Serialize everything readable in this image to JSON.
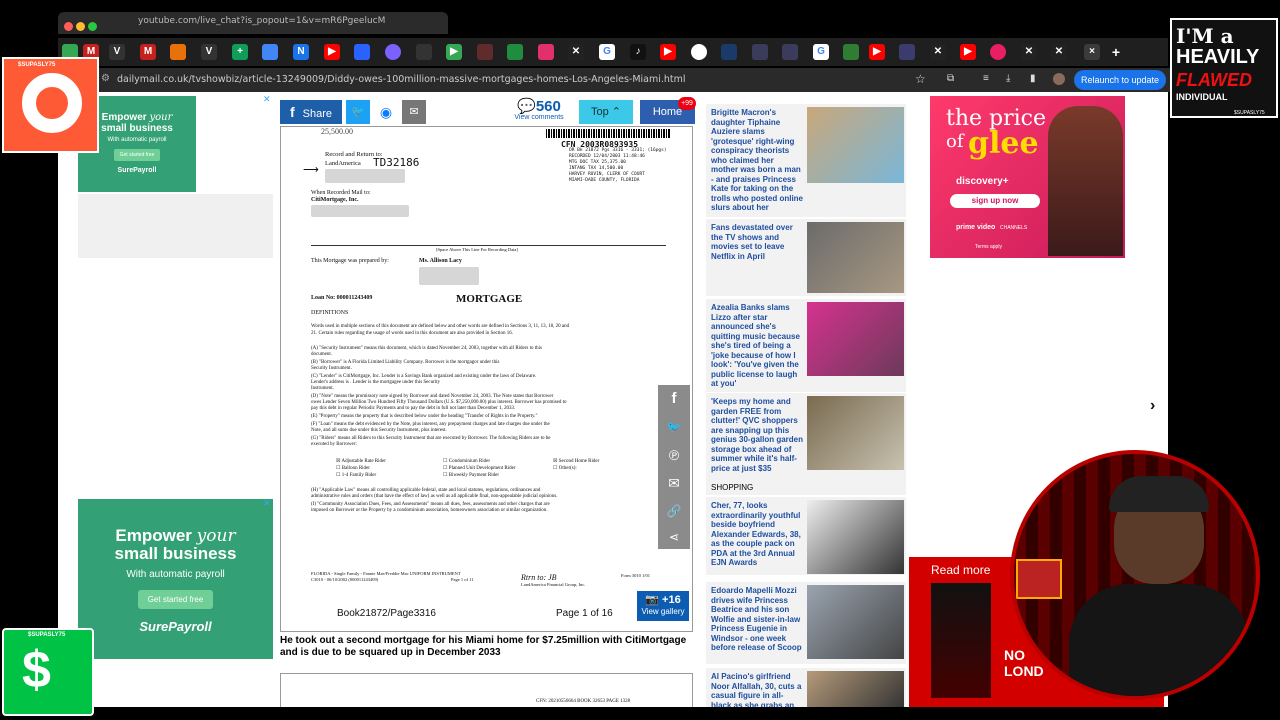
{
  "popout": {
    "url": "youtube.com/live_chat?is_popout=1&v=mR6PgeelucM"
  },
  "browser": {
    "url": "dailymail.co.uk/tvshowbiz/article-13249009/Diddy-owes-100million-massive-mortgages-homes-Los-Angeles-Miami.html",
    "relaunch_label": "Relaunch to update"
  },
  "ads": {
    "top": {
      "headline1": "Empower",
      "headline_italic": "your",
      "headline2": "small business",
      "sub": "With automatic payroll",
      "btn": "Get started free",
      "brand": "SurePayroll"
    },
    "bottom": {
      "headline1": "Empower",
      "headline_italic": "your",
      "headline2": "small business",
      "sub": "With automatic payroll",
      "btn": "Get started free",
      "brand": "SurePayroll"
    }
  },
  "share_bar": {
    "share": "Share",
    "comments_count": "560",
    "comments_label": "View comments",
    "top": "Top",
    "home": "Home",
    "badge": "+99"
  },
  "document": {
    "record_return": "Record and Return to:",
    "landamerica": "LandAmerica",
    "handwritten": "TD32186",
    "cfn": "CFN 2003R0893935",
    "book_line": "OR Bk 21872 Pgs 3316 - 3331; (16pgs)",
    "recorded": "RECORDED 12/04/2003 11:48:46",
    "mtg_doc": "MTG DOC TAX 25,375.00",
    "intang": "INTANG TAX 14,500.00",
    "harvey": "HARVEY RUVIN, CLERK OF COURT",
    "county": "MIAMI-DADE COUNTY, FLORIDA",
    "when_recorded": "When Recorded Mail to:",
    "citimortgage": "CitiMortgage, Inc.",
    "space_above": "[Space Above This Line For Recording Data]",
    "prepared_by": "This Mortgage was prepared by:",
    "prepared_name": "Ms. Allison Lacy",
    "loan_no": "Loan No: 000011243409",
    "title": "MORTGAGE",
    "definitions": "DEFINITIONS",
    "p1": "Words used in multiple sections of this document are defined below and other words are defined in Sections 3, 11, 13, 18, 20 and",
    "p1b": "21. Certain rules regarding the usage of words used in this document are also provided in Section 16.",
    "a": "(A)      \"Security Instrument\" means this document, which is dated November 24, 2003, together with all Riders to this",
    "a2": "document.",
    "b": "(B)      \"Borrower\" is                                     A Florida Limited Liability Company.  Borrower is the mortgagor under this",
    "b2": "Security Instrument.",
    "c": "(C)      \"Lender\" is CitiMortgage, Inc.  Lender is a Savings Bank organized and existing under the laws of Delaware.",
    "c2": "Lender's address is                                                               . Lender is the mortgagee under this Security",
    "c3": "Instrument.",
    "d": "(D)      \"Note\" means the promissory note signed by Borrower and dated November 24, 2003.  The Note states that Borrower",
    "d2": "owes Lender Seven Million Two Hundred Fifty Thousand Dollars (U.S. $7,250,000.00) plus interest.  Borrower has promised to",
    "d3": "pay this debt in regular Periodic Payments and to pay the debt in full not later than December 1, 2033.",
    "e": "(E)      \"Property\" means the property that is described below under the heading \"Transfer of Rights in the Property.\"",
    "f": "(F)      \"Loan\" means the debt evidenced by the Note, plus interest, any prepayment charges and late charges due under the",
    "f2": "Note, and all sums due under this Security Instrument, plus interest.",
    "g": "(G)      \"Riders\" means all Riders to this Security Instrument that are executed by Borrower.  The following Riders are to be",
    "g2": "executed by Borrower:",
    "riders": [
      "Adjustable Rate Rider",
      "Balloon Rider",
      "1-4 Family Rider",
      "Condominium Rider",
      "Planned Unit Development Rider",
      "Biweekly Payment Rider",
      "Second Home Rider",
      "Other(s):"
    ],
    "h": "(H)      \"Applicable Law\" means all controlling applicable federal, state and local statutes, regulations, ordinances and",
    "h2": "administrative rules and orders (that have the effect of law) as well as all applicable final, non-appealable judicial opinions.",
    "i": "(I)      \"Community Association Dues, Fees, and Assessments\" means all dues, fees, assessments and other charges that are",
    "i2": "imposed on Borrower or the Property by a condominium association, homeowners association or similar organization.",
    "footer": "FLORIDA - Single Family - Fannie Mae/Freddie Mac UNIFORM INSTRUMENT",
    "page_of": "Page 1 of 11",
    "form": "Form 3010 1/01",
    "footer_code": "C3010 - 06/10/2002 (000011243409)",
    "landamerica_fin": "LandAmerica Financial Group, Inc.",
    "book_page": "Book21872/Page3316",
    "page_label": "Page 1 of 16",
    "gallery_count": "+16",
    "gallery_label": "View gallery"
  },
  "caption": "He took out a second mortgage for his Miami home for $7.25million with CitiMortgage and is due to be squared up in December 2033",
  "doc2_footer": "CFN: 20210556664 BOOK 32653 PAGE 1328",
  "sidebar": [
    {
      "text": "Brigitte Macron's daughter Tiphaine Auziere slams 'grotesque' right-wing conspiracy theorists who claimed her mother was born a man - and praises Princess Kate for taking on the trolls who posted online slurs about her",
      "tag": ""
    },
    {
      "text": "Fans devastated over the TV shows and movies set to leave Netflix in April",
      "tag": ""
    },
    {
      "text": "Azealia Banks slams Lizzo after star announced she's quitting music because she's tired of being a 'joke because of how I look': 'You've given the public license to laugh at you'",
      "tag": ""
    },
    {
      "text": "'Keeps my home and garden FREE from clutter!' QVC shoppers are snapping up this genius 30-gallon garden storage box ahead of summer while it's half-price at just $35",
      "tag": "SHOPPING"
    },
    {
      "text": "Cher, 77, looks extraordinarily youthful beside boyfriend Alexander Edwards, 38, as the couple pack on PDA at the 3rd Annual EJN Awards",
      "tag": ""
    },
    {
      "text": "Edoardo Mapelli Mozzi drives wife Princess Beatrice and his son Wolfie and sister-in-law Princess Eugenie in Windsor - one week before release of Scoop",
      "tag": ""
    },
    {
      "text": "Al Pacino's girlfriend Noor Alfallah, 30, cuts a casual figure in all-black as she grabs an",
      "tag": ""
    }
  ],
  "glee_ad": {
    "line1": "the price",
    "line2": "of",
    "line3": "glee",
    "brand": "discovery+",
    "btn": "sign up now",
    "prime": "prime video",
    "channels": "CHANNELS",
    "terms": "Terms apply"
  },
  "read_more": {
    "label": "Read more",
    "london": "NO",
    "london2": "LOND"
  },
  "overlays": {
    "banner1": "I'M a",
    "banner2": "HEAVILY",
    "banner3": "FLAWED",
    "banner4": "INDIVIDUAL",
    "handle": "$SUPASLY75"
  },
  "colors": {
    "share_blue": "#1d5fa8",
    "twitter": "#1da1f2",
    "comments": "#0c5db2",
    "dm_blue": "#2e5fae",
    "accent_red": "#d30000"
  }
}
